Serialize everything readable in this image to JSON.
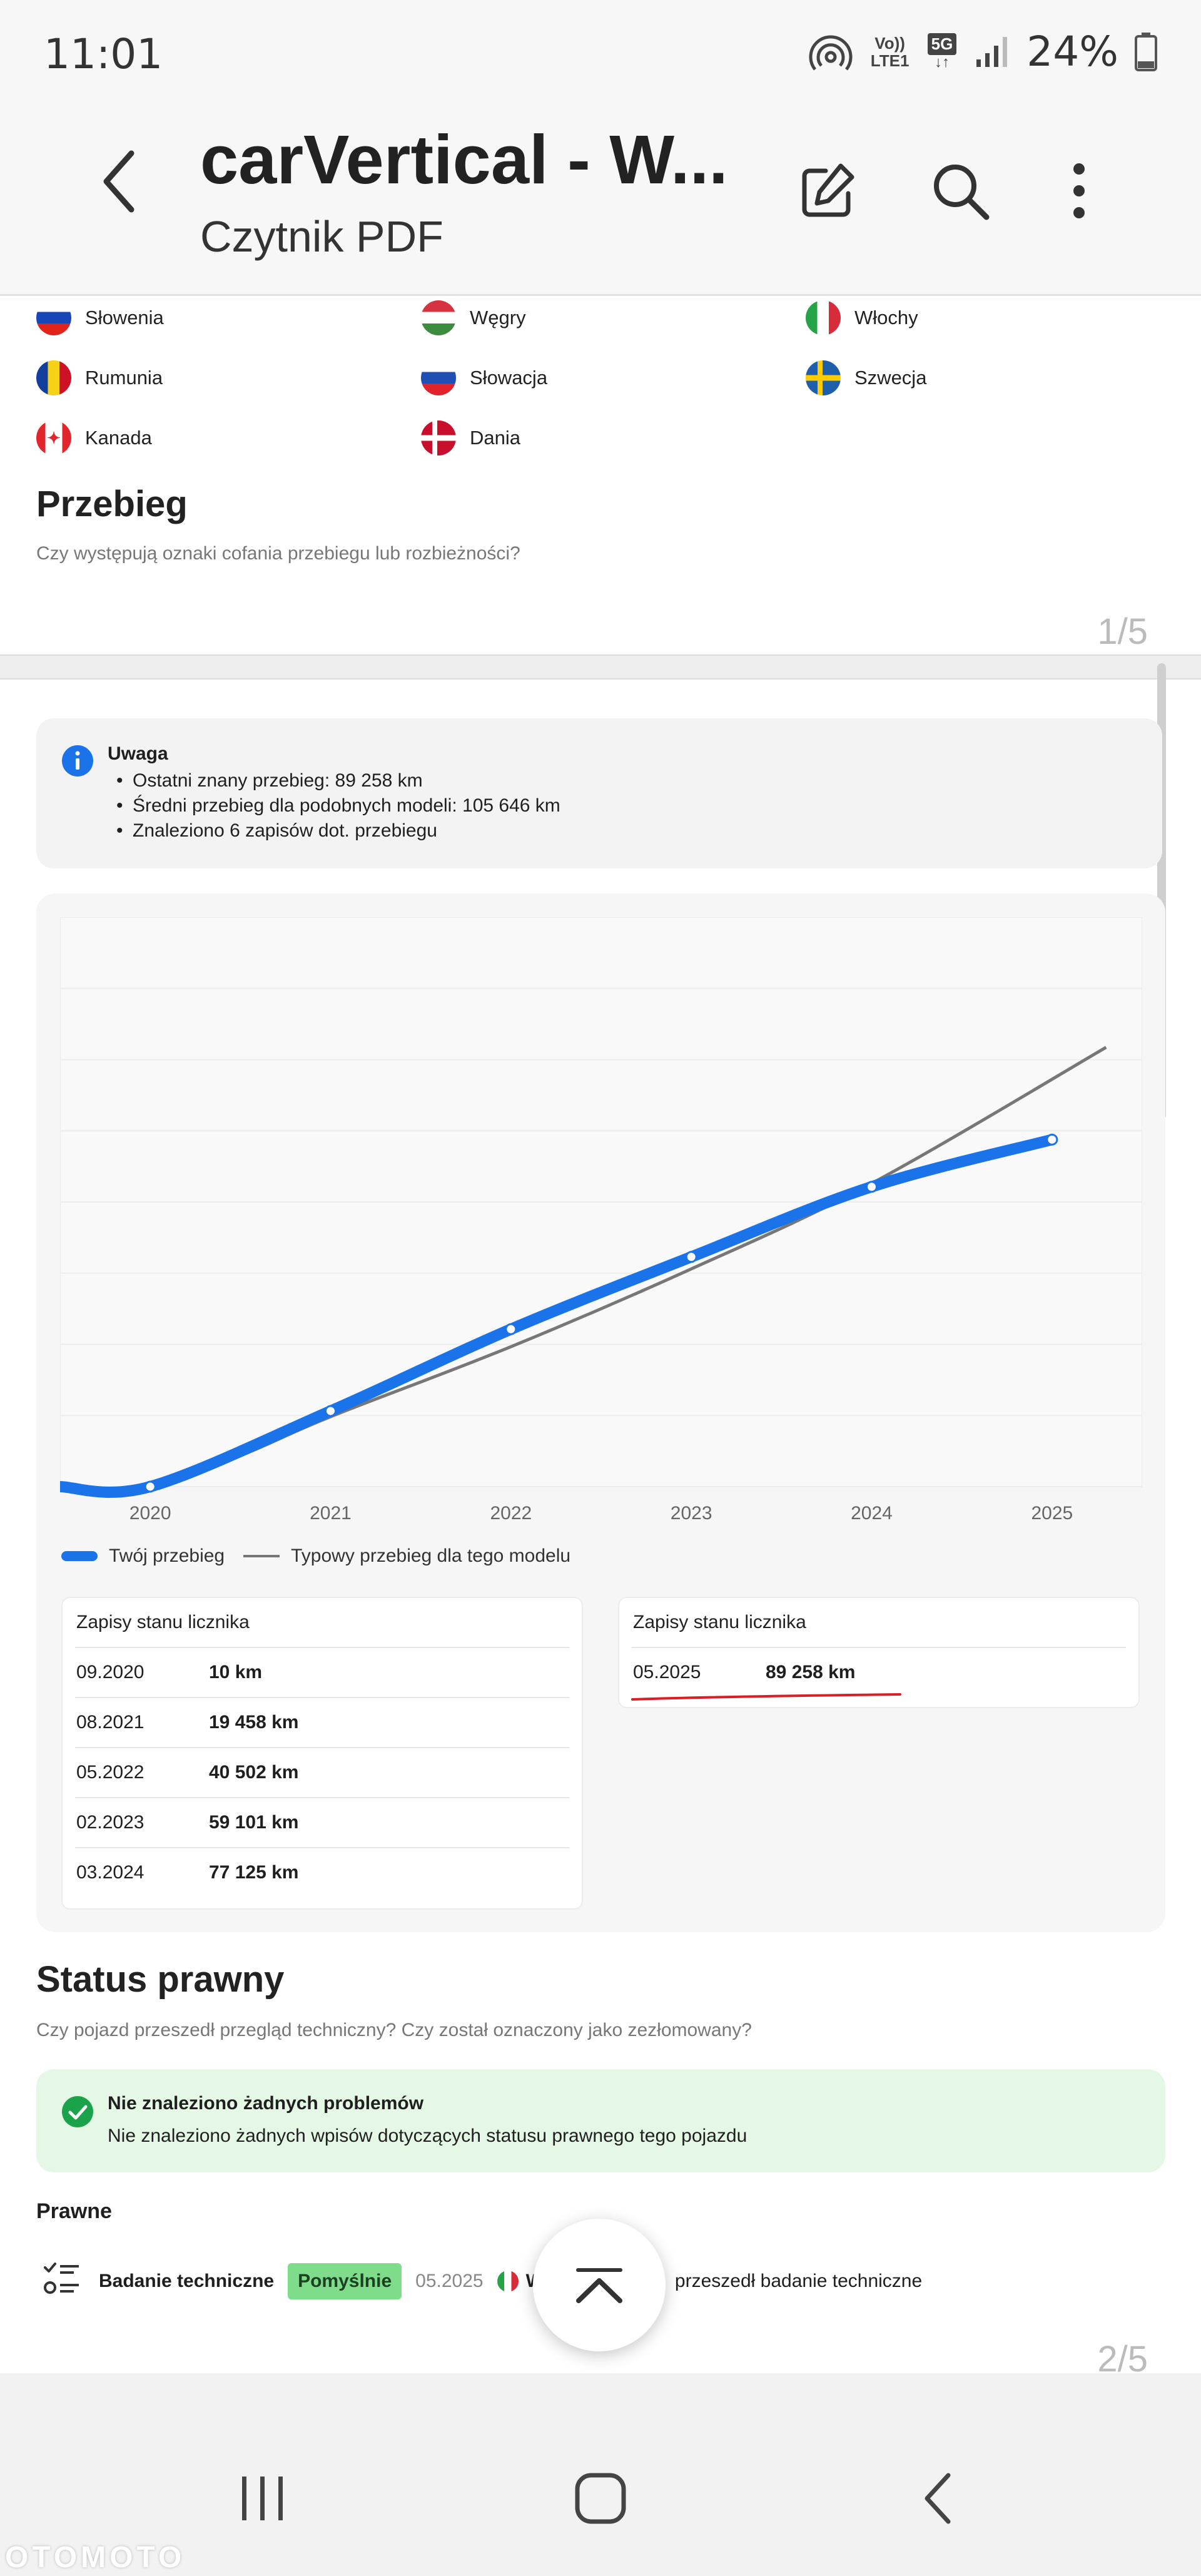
{
  "status_bar": {
    "time": "11:01",
    "battery": "24%",
    "icons": [
      "hotspot-icon",
      "volte-icon",
      "5g-icon",
      "signal-icon",
      "battery-icon"
    ],
    "volte_label": "Vo)) LTE1",
    "network_label": "5G"
  },
  "app_bar": {
    "title": "carVertical - W...",
    "subtitle": "Czytnik PDF",
    "icons": [
      "back-arrow-icon",
      "edit-icon",
      "search-icon",
      "more-vert-icon"
    ]
  },
  "countries": [
    {
      "name": "Słowenia",
      "flag": "slovenia-flag-icon"
    },
    {
      "name": "Węgry",
      "flag": "hungary-flag-icon"
    },
    {
      "name": "Włochy",
      "flag": "italy-flag-icon"
    },
    {
      "name": "Rumunia",
      "flag": "romania-flag-icon"
    },
    {
      "name": "Słowacja",
      "flag": "slovakia-flag-icon"
    },
    {
      "name": "Szwecja",
      "flag": "sweden-flag-icon"
    },
    {
      "name": "Kanada",
      "flag": "canada-flag-icon"
    },
    {
      "name": "Dania",
      "flag": "denmark-flag-icon"
    }
  ],
  "mileage": {
    "title": "Przebieg",
    "subtitle": "Czy występują oznaki cofania przebiegu lub rozbieżności?",
    "page_indicator": "1/5",
    "note": {
      "title": "Uwaga",
      "items": [
        "Ostatni znany przebieg: 89 258 km",
        "Średni przebieg dla podobnych modeli: 105 646 km",
        "Znaleziono 6 zapisów dot. przebiegu"
      ]
    },
    "legend": {
      "yours": "Twój przebieg",
      "typical": "Typowy przebieg dla tego modelu"
    },
    "records_left": {
      "title": "Zapisy stanu licznika",
      "rows": [
        {
          "date": "09.2020",
          "value": "10 km"
        },
        {
          "date": "08.2021",
          "value": "19 458 km"
        },
        {
          "date": "05.2022",
          "value": "40 502 km"
        },
        {
          "date": "02.2023",
          "value": "59 101 km"
        },
        {
          "date": "03.2024",
          "value": "77 125 km"
        }
      ]
    },
    "records_right": {
      "title": "Zapisy stanu licznika",
      "rows": [
        {
          "date": "05.2025",
          "value": "89 258 km"
        }
      ]
    }
  },
  "chart_data": {
    "type": "line",
    "x_ticks": [
      "2020",
      "2021",
      "2022",
      "2023",
      "2024",
      "2025"
    ],
    "xlim": [
      2019.5,
      2025.5
    ],
    "ylim": [
      0,
      140000
    ],
    "grid": true,
    "series": [
      {
        "name": "Twój przebieg",
        "color": "#1a73e8",
        "points": [
          [
            2019.5,
            10
          ],
          [
            2020.0,
            10
          ],
          [
            2021.0,
            19458
          ],
          [
            2022.0,
            40502
          ],
          [
            2023.0,
            59101
          ],
          [
            2024.0,
            77125
          ],
          [
            2025.0,
            89258
          ]
        ]
      },
      {
        "name": "Typowy przebieg dla tego modelu",
        "color": "#777777",
        "points": [
          [
            2020.0,
            0
          ],
          [
            2020.5,
            8000
          ],
          [
            2021.0,
            18000
          ],
          [
            2022.0,
            36000
          ],
          [
            2023.0,
            56000
          ],
          [
            2024.0,
            78000
          ],
          [
            2025.3,
            113000
          ]
        ]
      }
    ]
  },
  "legal": {
    "title": "Status prawny",
    "subtitle": "Czy pojazd przeszedł przegląd techniczny? Czy został oznaczony jako zezłomowany?",
    "success_title": "Nie znaleziono żadnych problemów",
    "success_text": "Nie znaleziono żadnych wpisów dotyczących statusu prawnego tego pojazdu",
    "section_label": "Prawne",
    "inspection": {
      "label": "Badanie techniczne",
      "status": "Pomyślnie",
      "date": "05.2025",
      "country_initial": "W",
      "text": "przeszedł badanie techniczne"
    },
    "page_indicator": "2/5"
  },
  "colors": {
    "accent_blue": "#1a73e8",
    "success_green": "#1aa34a",
    "info_blue": "#1a73e8",
    "underline_red": "#d91f26"
  },
  "bottom_nav": {
    "icons": [
      "recent-apps-icon",
      "home-icon",
      "back-icon"
    ]
  },
  "watermark": "OTOMOTO"
}
